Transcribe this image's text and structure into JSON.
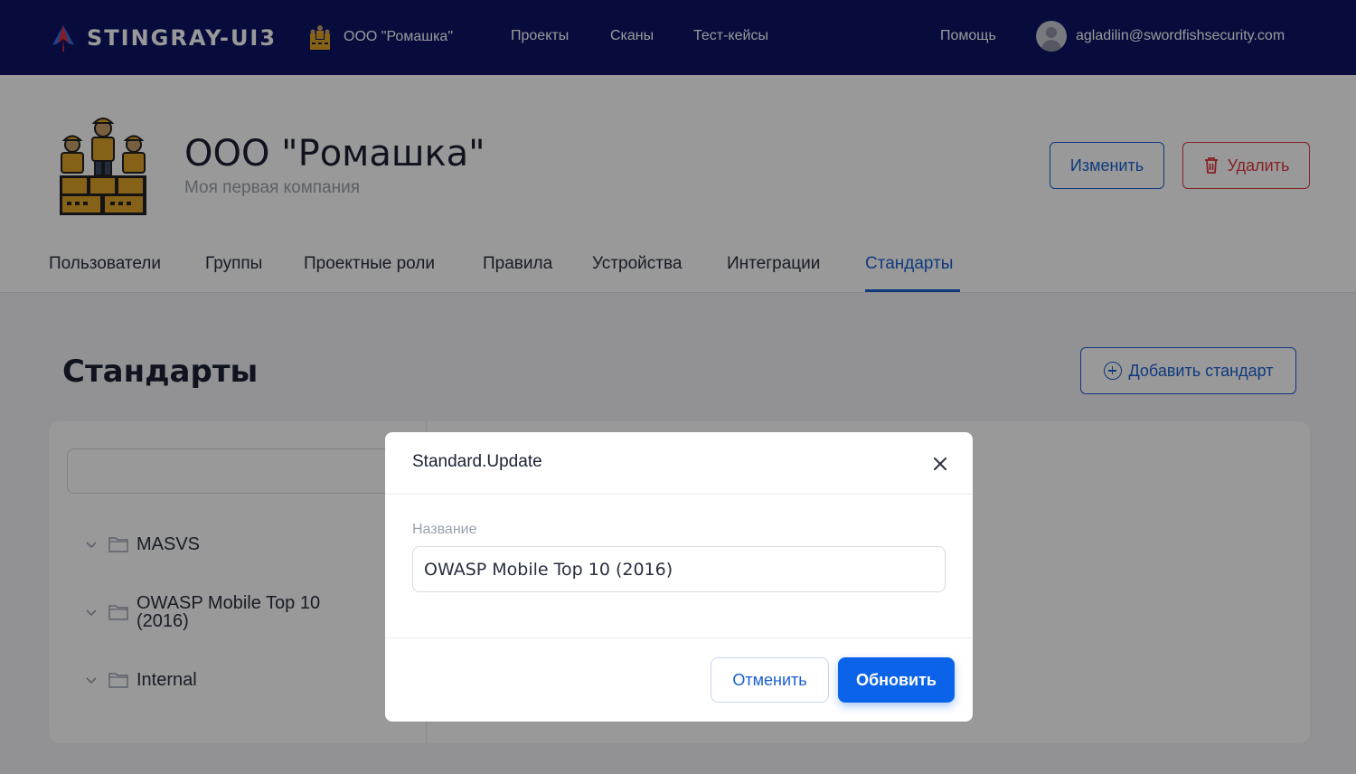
{
  "topbar": {
    "logo_text": "STINGRAY-UI3",
    "company_selector": "ООО \"Ромашка\"",
    "nav": [
      "Проекты",
      "Сканы",
      "Тест-кейсы"
    ],
    "help": "Помощь",
    "user_email": "agladilin@swordfishsecurity.com",
    "background_color": "#0c1466"
  },
  "company": {
    "name": "ООО \"Ромашка\"",
    "description": "Моя первая компания",
    "edit_label": "Изменить",
    "delete_label": "Удалить"
  },
  "tabs": {
    "items": [
      "Пользователи",
      "Группы",
      "Проектные роли",
      "Правила",
      "Устройства",
      "Интеграции",
      "Стандарты"
    ],
    "active": "Стандарты"
  },
  "standards": {
    "title": "Стандарты",
    "add_label": "Добавить стандарт",
    "search_placeholder": "",
    "tree": [
      "MASVS",
      "OWASP Mobile Top 10 (2016)",
      "Internal"
    ]
  },
  "modal": {
    "title": "Standard.Update",
    "field_label": "Название",
    "field_value": "OWASP Mobile Top 10 (2016)",
    "cancel_label": "Отменить",
    "submit_label": "Обновить",
    "primary_color": "#0a63e8"
  },
  "icons": {
    "logo": "stingray-logo-icon",
    "company": "workers-company-icon",
    "delete": "trash-icon",
    "add": "plus-circle-icon",
    "tree_expand": "chevron-down-icon",
    "tree_folder": "folder-icon",
    "close": "close-icon",
    "avatar": "user-avatar-icon"
  }
}
